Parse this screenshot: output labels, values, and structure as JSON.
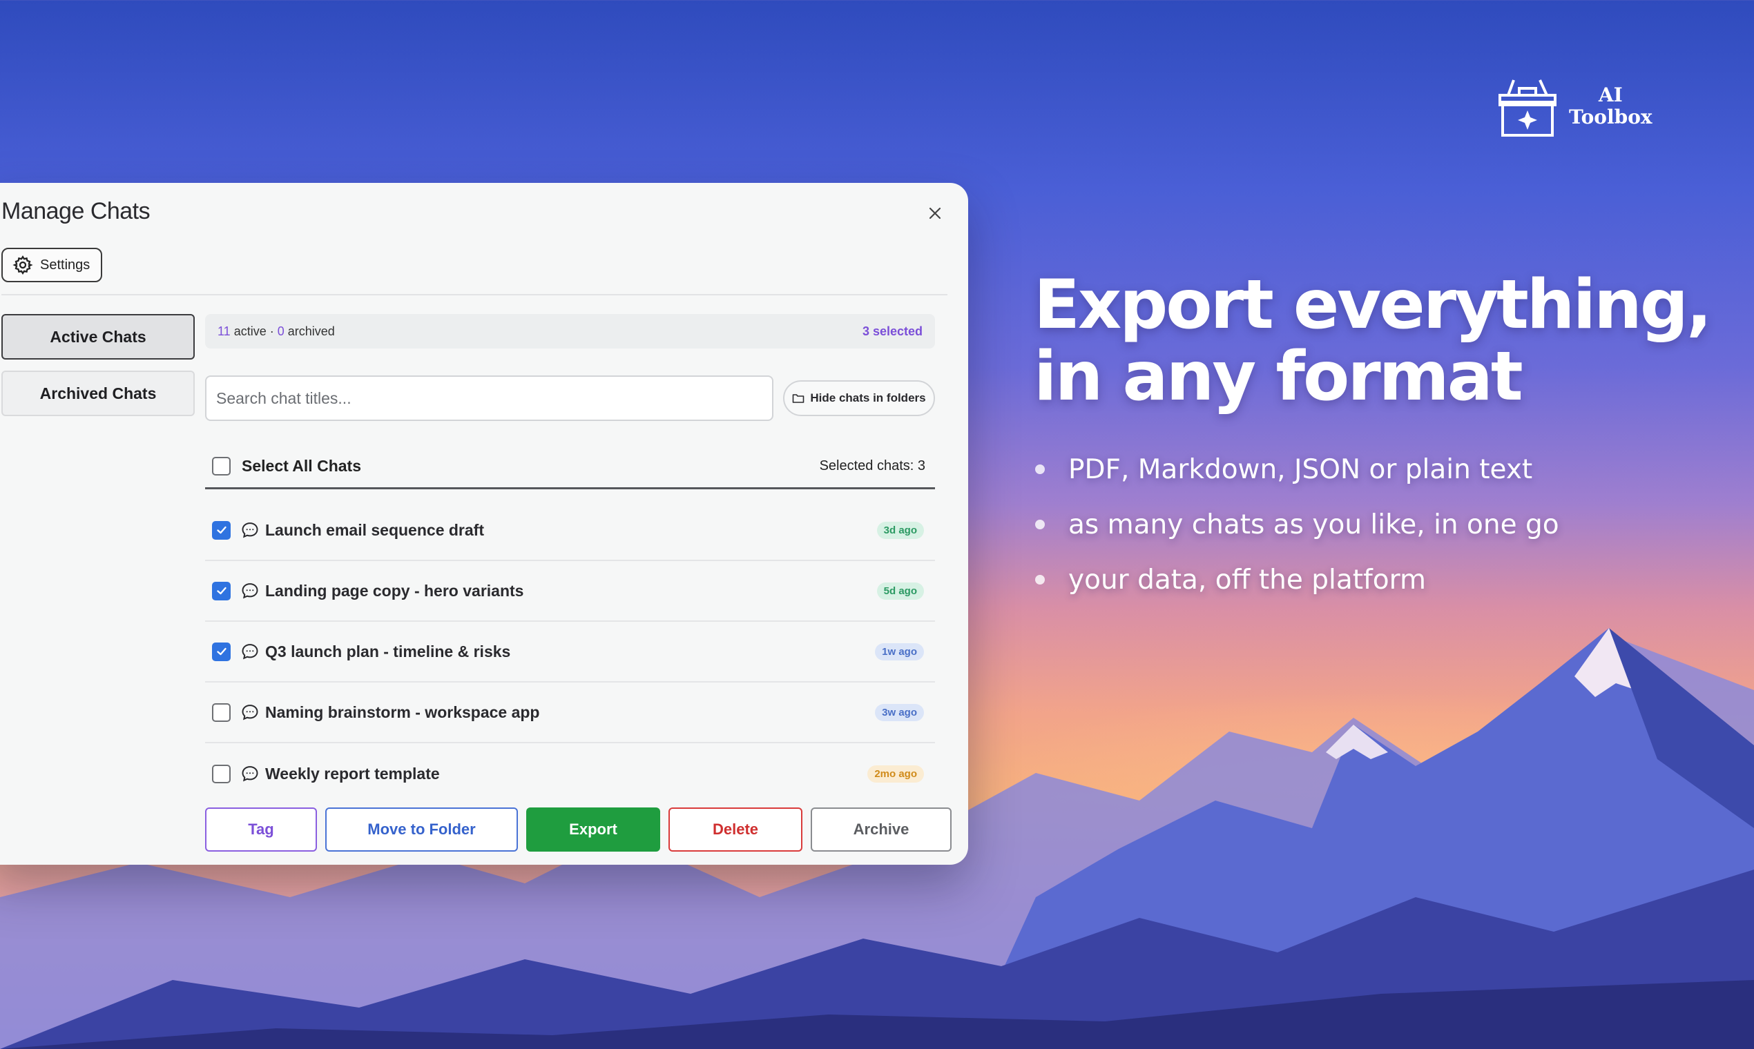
{
  "brand": {
    "line1": "AI",
    "line2": "Toolbox"
  },
  "headline": {
    "line1": "Export everything,",
    "line2": "in any format"
  },
  "bullets": [
    "PDF, Markdown, JSON or plain text",
    "as many chats as you like, in one go",
    "your data, off the platform"
  ],
  "dialog": {
    "title": "Manage Chats",
    "settings_label": "Settings",
    "tabs": {
      "active": "Active Chats",
      "archived": "Archived Chats"
    },
    "stats": {
      "active_count": "11",
      "active_word": "active",
      "separator": " · ",
      "archived_count": "0",
      "archived_word": "archived",
      "selected": "3 selected"
    },
    "search": {
      "placeholder": "Search chat titles..."
    },
    "hide_label": "Hide chats in folders",
    "select_all_label": "Select All Chats",
    "selected_chats": "Selected chats: 3",
    "chats": [
      {
        "title": "Launch email sequence draft",
        "age": "3d ago",
        "checked": true,
        "badge_color": "green"
      },
      {
        "title": "Landing page copy - hero variants",
        "age": "5d ago",
        "checked": true,
        "badge_color": "green"
      },
      {
        "title": "Q3 launch plan - timeline & risks",
        "age": "1w ago",
        "checked": true,
        "badge_color": "blue"
      },
      {
        "title": "Naming brainstorm - workspace app",
        "age": "3w ago",
        "checked": false,
        "badge_color": "blue"
      },
      {
        "title": "Weekly report template",
        "age": "2mo ago",
        "checked": false,
        "badge_color": "amber"
      }
    ],
    "actions": {
      "tag": "Tag",
      "move": "Move to Folder",
      "export": "Export",
      "delete": "Delete",
      "archive": "Archive"
    }
  },
  "colors": {
    "accent": "#7b4fd8",
    "checkbox": "#2f73e0",
    "export": "#1f9d3f",
    "delete": "#d93b3b"
  },
  "icons": {
    "close": "close-icon",
    "settings": "gear-icon",
    "folder": "folder-icon",
    "chat": "chat-bubble-icon",
    "brand": "toolbox-icon"
  }
}
